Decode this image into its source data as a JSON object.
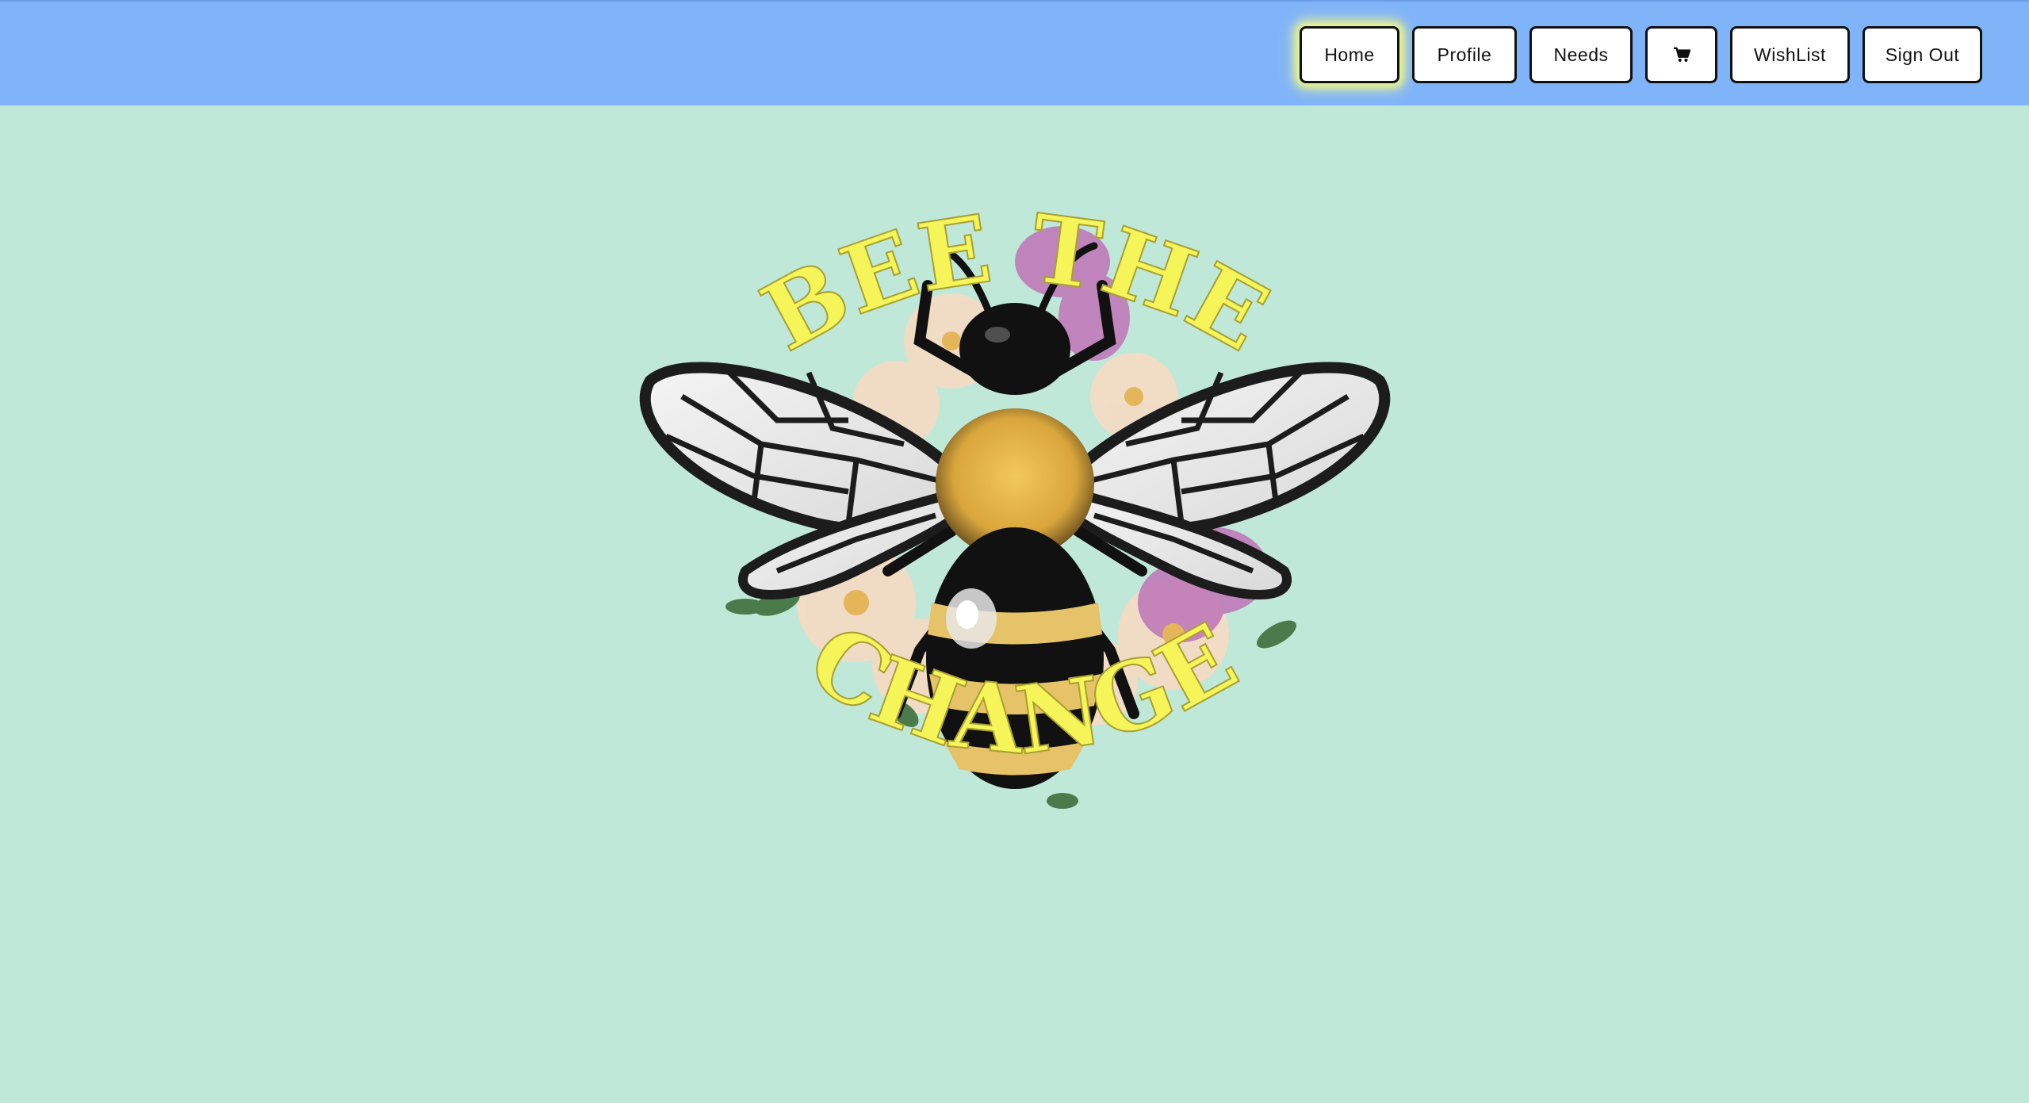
{
  "nav": {
    "home": "Home",
    "profile": "Profile",
    "needs": "Needs",
    "cart_icon": "shopping-cart-icon",
    "wishlist": "WishList",
    "signout": "Sign Out"
  },
  "hero": {
    "line1": "BEE THE",
    "line2": "CHANGE"
  },
  "colors": {
    "page_background": "#bfe8d9",
    "topbar_background": "#80b4f9",
    "logo_text": "#f5f55a",
    "active_glow": "#eef58a"
  }
}
